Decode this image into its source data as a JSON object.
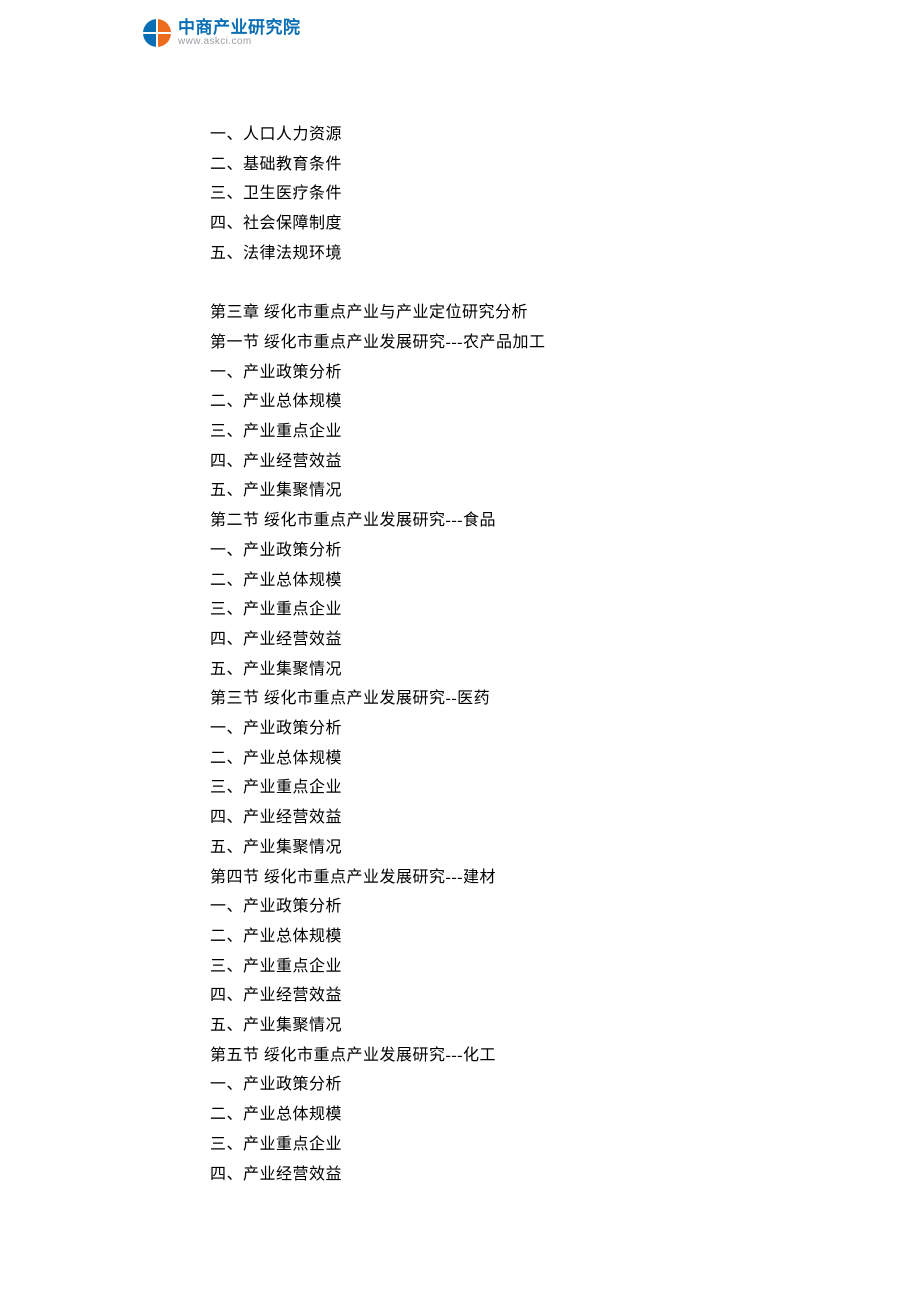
{
  "header": {
    "brand_title": "中商产业研究院",
    "brand_sub": "www.askci.com"
  },
  "content": {
    "lines": [
      "一、人口人力资源",
      "二、基础教育条件",
      "三、卫生医疗条件",
      "四、社会保障制度",
      "五、法律法规环境",
      "",
      "第三章 绥化市重点产业与产业定位研究分析",
      "第一节 绥化市重点产业发展研究---农产品加工",
      "一、产业政策分析",
      "二、产业总体规模",
      "三、产业重点企业",
      "四、产业经营效益",
      "五、产业集聚情况",
      "第二节 绥化市重点产业发展研究---食品",
      "一、产业政策分析",
      "二、产业总体规模",
      "三、产业重点企业",
      "四、产业经营效益",
      "五、产业集聚情况",
      "第三节 绥化市重点产业发展研究--医药",
      "一、产业政策分析",
      "二、产业总体规模",
      "三、产业重点企业",
      "四、产业经营效益",
      "五、产业集聚情况",
      "第四节 绥化市重点产业发展研究---建材",
      "一、产业政策分析",
      "二、产业总体规模",
      "三、产业重点企业",
      "四、产业经营效益",
      "五、产业集聚情况",
      "第五节 绥化市重点产业发展研究---化工",
      "一、产业政策分析",
      "二、产业总体规模",
      "三、产业重点企业",
      "四、产业经营效益"
    ]
  }
}
